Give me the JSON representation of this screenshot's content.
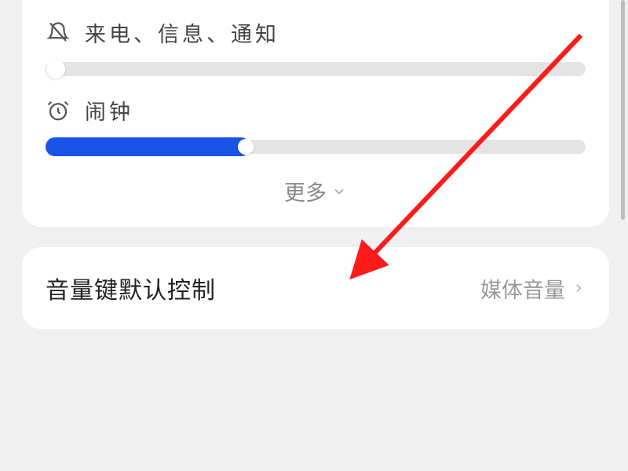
{
  "volumes": {
    "notifications": {
      "label": "来电、信息、通知",
      "value_percent": 0
    },
    "alarm": {
      "label": "闹钟",
      "value_percent": 38
    }
  },
  "more_label": "更多",
  "volume_key_control": {
    "title": "音量键默认控制",
    "value": "媒体音量"
  }
}
